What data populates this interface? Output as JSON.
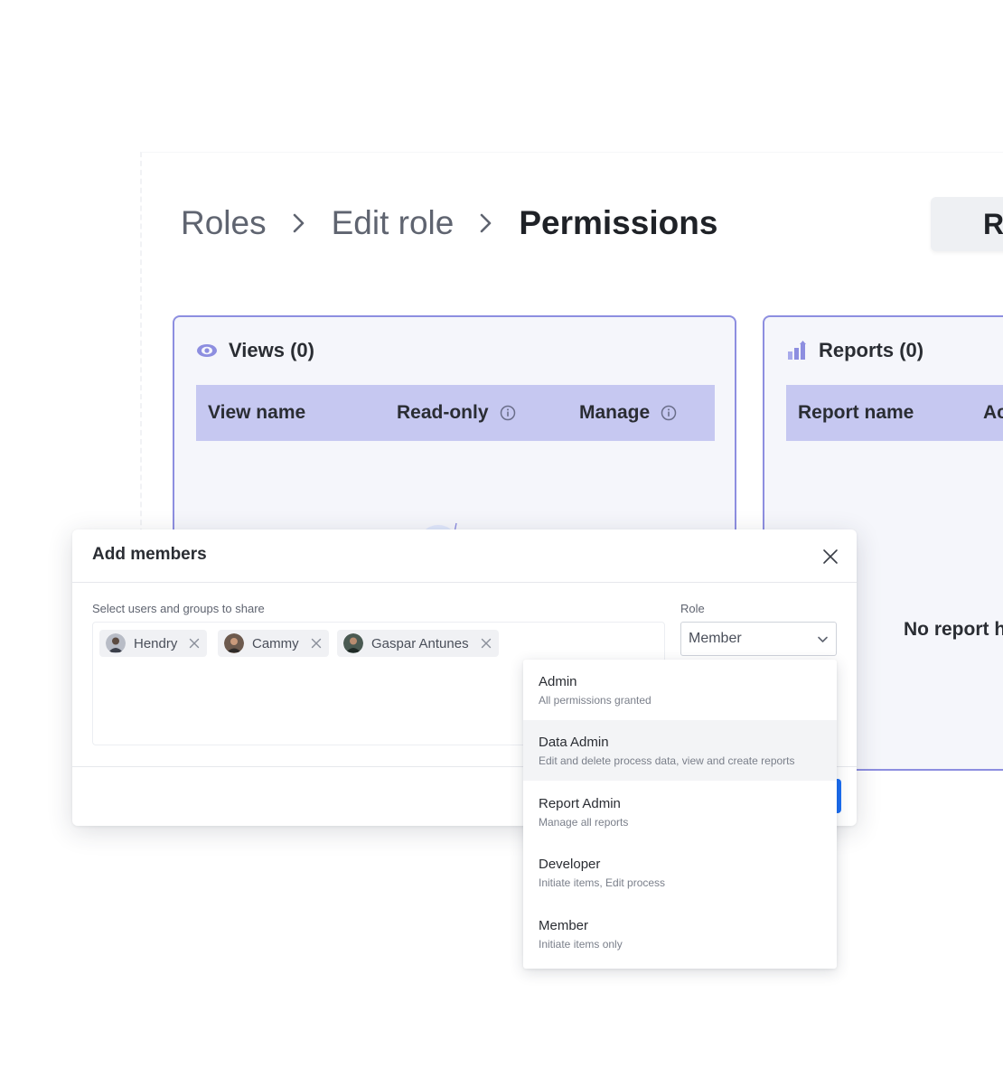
{
  "breadcrumb": {
    "items": [
      "Roles",
      "Edit role"
    ],
    "current": "Permissions"
  },
  "top_action": {
    "label": "Re"
  },
  "views_panel": {
    "title": "Views (0)",
    "icon": "eye-icon",
    "columns": [
      "View name",
      "Read-only",
      "Manage"
    ]
  },
  "reports_panel": {
    "title": "Reports (0)",
    "icon": "bar-chart-icon",
    "columns": [
      "Report name",
      "Ac"
    ],
    "empty_text": "No report h"
  },
  "dialog": {
    "title": "Add members",
    "users_label": "Select users and groups to share",
    "role_label": "Role",
    "selected_members": [
      {
        "name": "Hendry"
      },
      {
        "name": "Cammy"
      },
      {
        "name": "Gaspar Antunes"
      }
    ],
    "role_value": "Member"
  },
  "role_options": [
    {
      "title": "Admin",
      "description": "All permissions granted"
    },
    {
      "title": "Data Admin",
      "description": "Edit and delete process data, view and create reports"
    },
    {
      "title": "Report Admin",
      "description": "Manage all reports"
    },
    {
      "title": "Developer",
      "description": "Initiate items, Edit process"
    },
    {
      "title": "Member",
      "description": "Initiate items only"
    }
  ],
  "colors": {
    "accent": "#8d8ee0",
    "table_header": "#c6c8f1",
    "panel_bg": "#f5f6fb",
    "primary": "#1b6ef3"
  }
}
